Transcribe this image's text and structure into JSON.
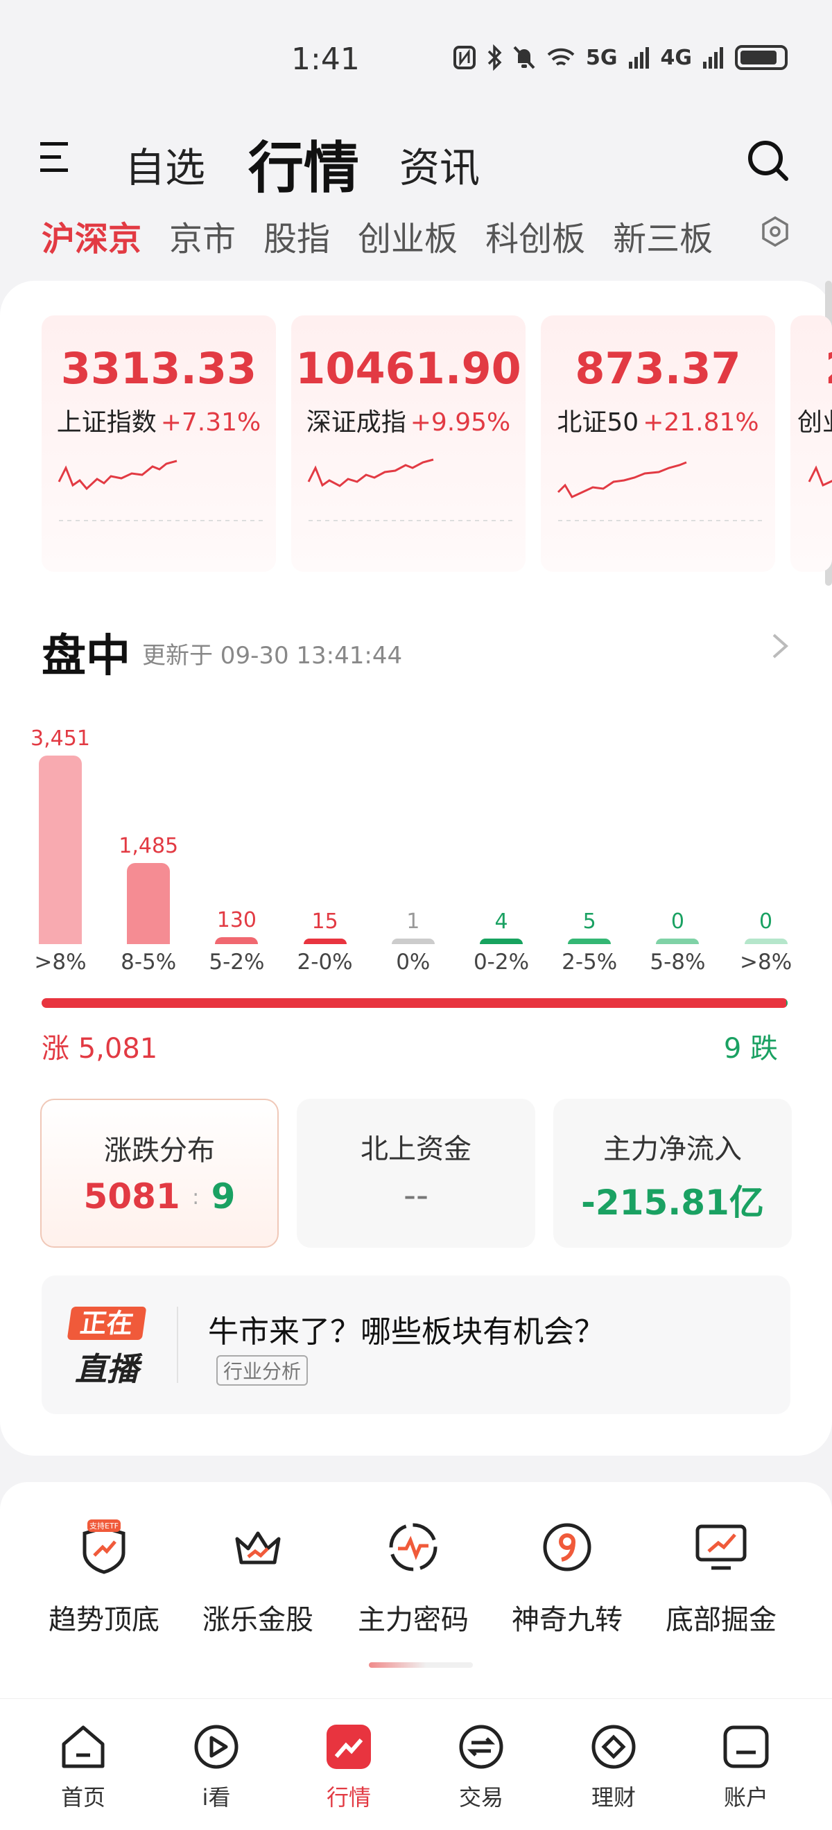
{
  "status_bar": {
    "time": "1:41",
    "icons": [
      "nfc-icon",
      "bluetooth-icon",
      "mute-icon",
      "wifi-icon",
      "5g-signal-icon",
      "4g-signal-icon",
      "battery-icon"
    ],
    "network_labels": [
      "5G",
      "4G"
    ]
  },
  "header": {
    "tabs": [
      {
        "label": "自选",
        "active": false
      },
      {
        "label": "行情",
        "active": true
      },
      {
        "label": "资讯",
        "active": false
      }
    ]
  },
  "market_tabs": [
    {
      "label": "沪深京",
      "active": true
    },
    {
      "label": "京市",
      "active": false
    },
    {
      "label": "股指",
      "active": false
    },
    {
      "label": "创业板",
      "active": false
    },
    {
      "label": "科创板",
      "active": false
    },
    {
      "label": "新三板",
      "active": false
    }
  ],
  "indices": [
    {
      "value": "3313.33",
      "name": "上证指数",
      "change": "+7.31%"
    },
    {
      "value": "10461.90",
      "name": "深证成指",
      "change": "+9.95%"
    },
    {
      "value": "873.37",
      "name": "北证50",
      "change": "+21.81%"
    },
    {
      "value": "2",
      "name": "创业",
      "change": ""
    }
  ],
  "intraday": {
    "title": "盘中",
    "updated": "更新于 09-30 13:41:44"
  },
  "chart_data": {
    "type": "bar",
    "categories": [
      ">8%",
      "8-5%",
      "5-2%",
      "2-0%",
      "0%",
      "0-2%",
      "2-5%",
      "5-8%",
      ">8%"
    ],
    "values": [
      3451,
      1485,
      130,
      15,
      1,
      4,
      5,
      0,
      0
    ],
    "value_labels": [
      "3,451",
      "1,485",
      "130",
      "15",
      "1",
      "4",
      "5",
      "0",
      "0"
    ],
    "colors": [
      "#f8aab0",
      "#f58c93",
      "#f06870",
      "#e8343f",
      "#cccccc",
      "#17a35f",
      "#34b774",
      "#7fd2a6",
      "#b5e6cb"
    ]
  },
  "breadth": {
    "up_label": "涨 5,081",
    "down_label": "9 跌",
    "up_ratio": 0.998
  },
  "stats": [
    {
      "title": "涨跌分布",
      "up": "5081",
      "separator": ":",
      "down": "9"
    },
    {
      "title": "北上资金",
      "value": "--"
    },
    {
      "title": "主力净流入",
      "value": "-215.81亿"
    }
  ],
  "live": {
    "badge_top": "正在",
    "badge_bottom": "直播",
    "title": "牛市来了？哪些板块有机会？",
    "tag": "行业分析"
  },
  "tools": [
    {
      "label": "趋势顶底",
      "icon": "shield-trend-icon",
      "badge": "支持ETF"
    },
    {
      "label": "涨乐金股",
      "icon": "crown-icon"
    },
    {
      "label": "主力密码",
      "icon": "pulse-icon"
    },
    {
      "label": "神奇九转",
      "icon": "nine-icon"
    },
    {
      "label": "底部掘金",
      "icon": "monitor-chart-icon"
    }
  ],
  "bottom_nav": [
    {
      "label": "首页",
      "icon": "home-icon",
      "active": false
    },
    {
      "label": "i看",
      "icon": "play-icon",
      "active": false
    },
    {
      "label": "行情",
      "icon": "market-icon",
      "active": true
    },
    {
      "label": "交易",
      "icon": "exchange-icon",
      "active": false
    },
    {
      "label": "理财",
      "icon": "wealth-icon",
      "active": false
    },
    {
      "label": "账户",
      "icon": "account-icon",
      "active": false
    }
  ],
  "colors": {
    "red": "#e23a43",
    "green": "#1aa162"
  }
}
